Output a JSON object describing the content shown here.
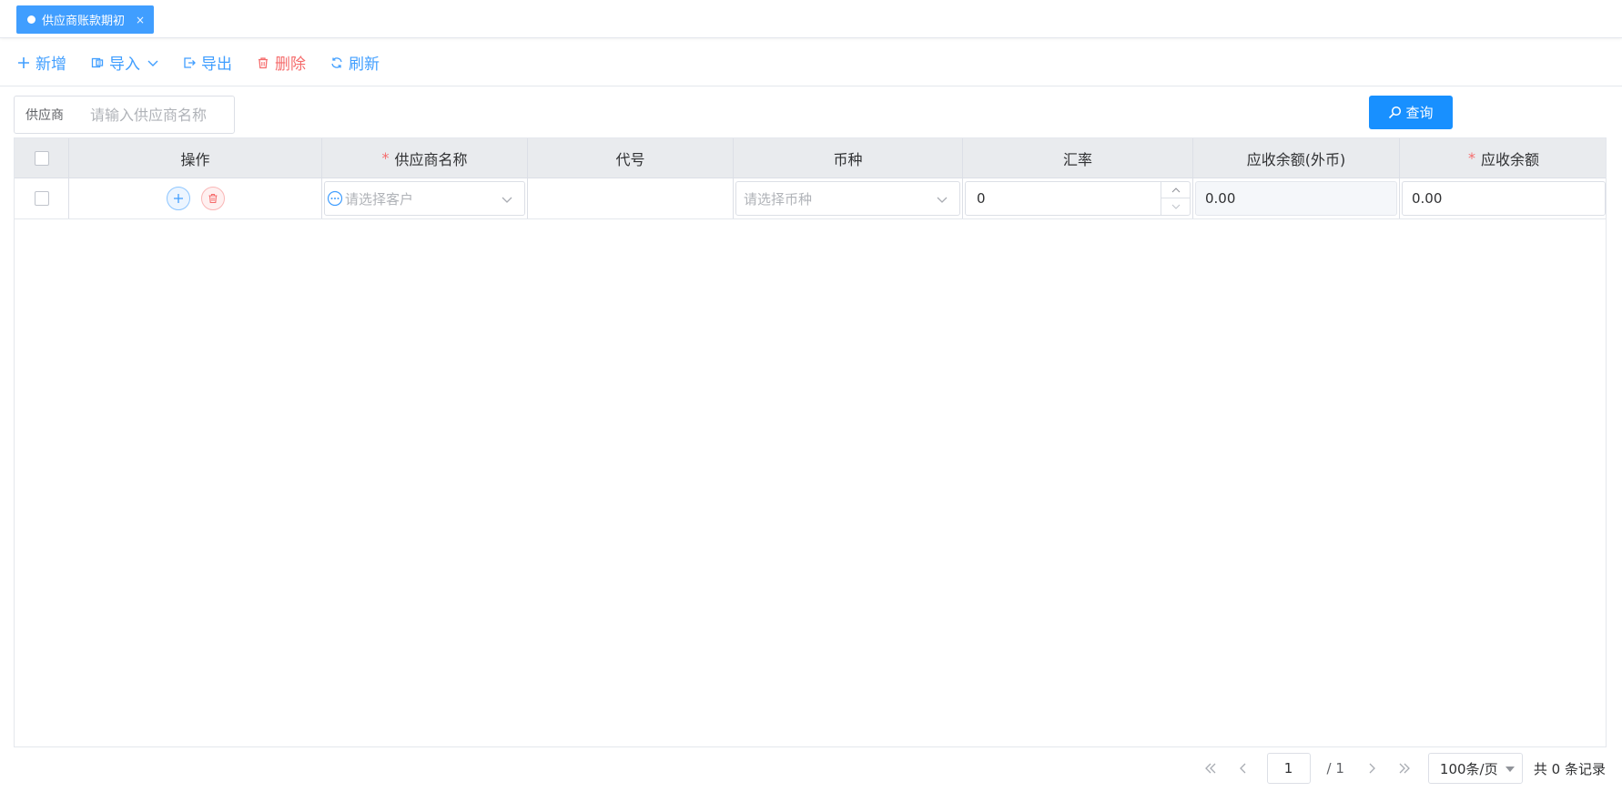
{
  "tab": {
    "label": "供应商账款期初",
    "close": "×"
  },
  "toolbar": {
    "add": "新增",
    "import": "导入",
    "export": "导出",
    "delete": "删除",
    "refresh": "刷新"
  },
  "filter": {
    "label": "供应商",
    "placeholder": "请输入供应商名称"
  },
  "query_button": "查询",
  "table": {
    "headers": {
      "action": "操作",
      "supplier_name": "供应商名称",
      "code": "代号",
      "currency": "币种",
      "exchange_rate": "汇率",
      "receivable_foreign": "应收余额(外币)",
      "receivable": "应收余额"
    },
    "required_mark": "*",
    "rows": [
      {
        "supplier_placeholder": "请选择客户",
        "code": "",
        "currency_placeholder": "请选择币种",
        "exchange_rate": "0",
        "receivable_foreign": "0.00",
        "receivable": "0.00"
      }
    ]
  },
  "pagination": {
    "current_page": "1",
    "total_pages": "/ 1",
    "page_size": "100条/页",
    "total_records": "共 0 条记录"
  },
  "colors": {
    "primary": "#409eff",
    "query_button": "#1890ff",
    "danger": "#f56c6c",
    "header_bg": "#e9ebee"
  }
}
